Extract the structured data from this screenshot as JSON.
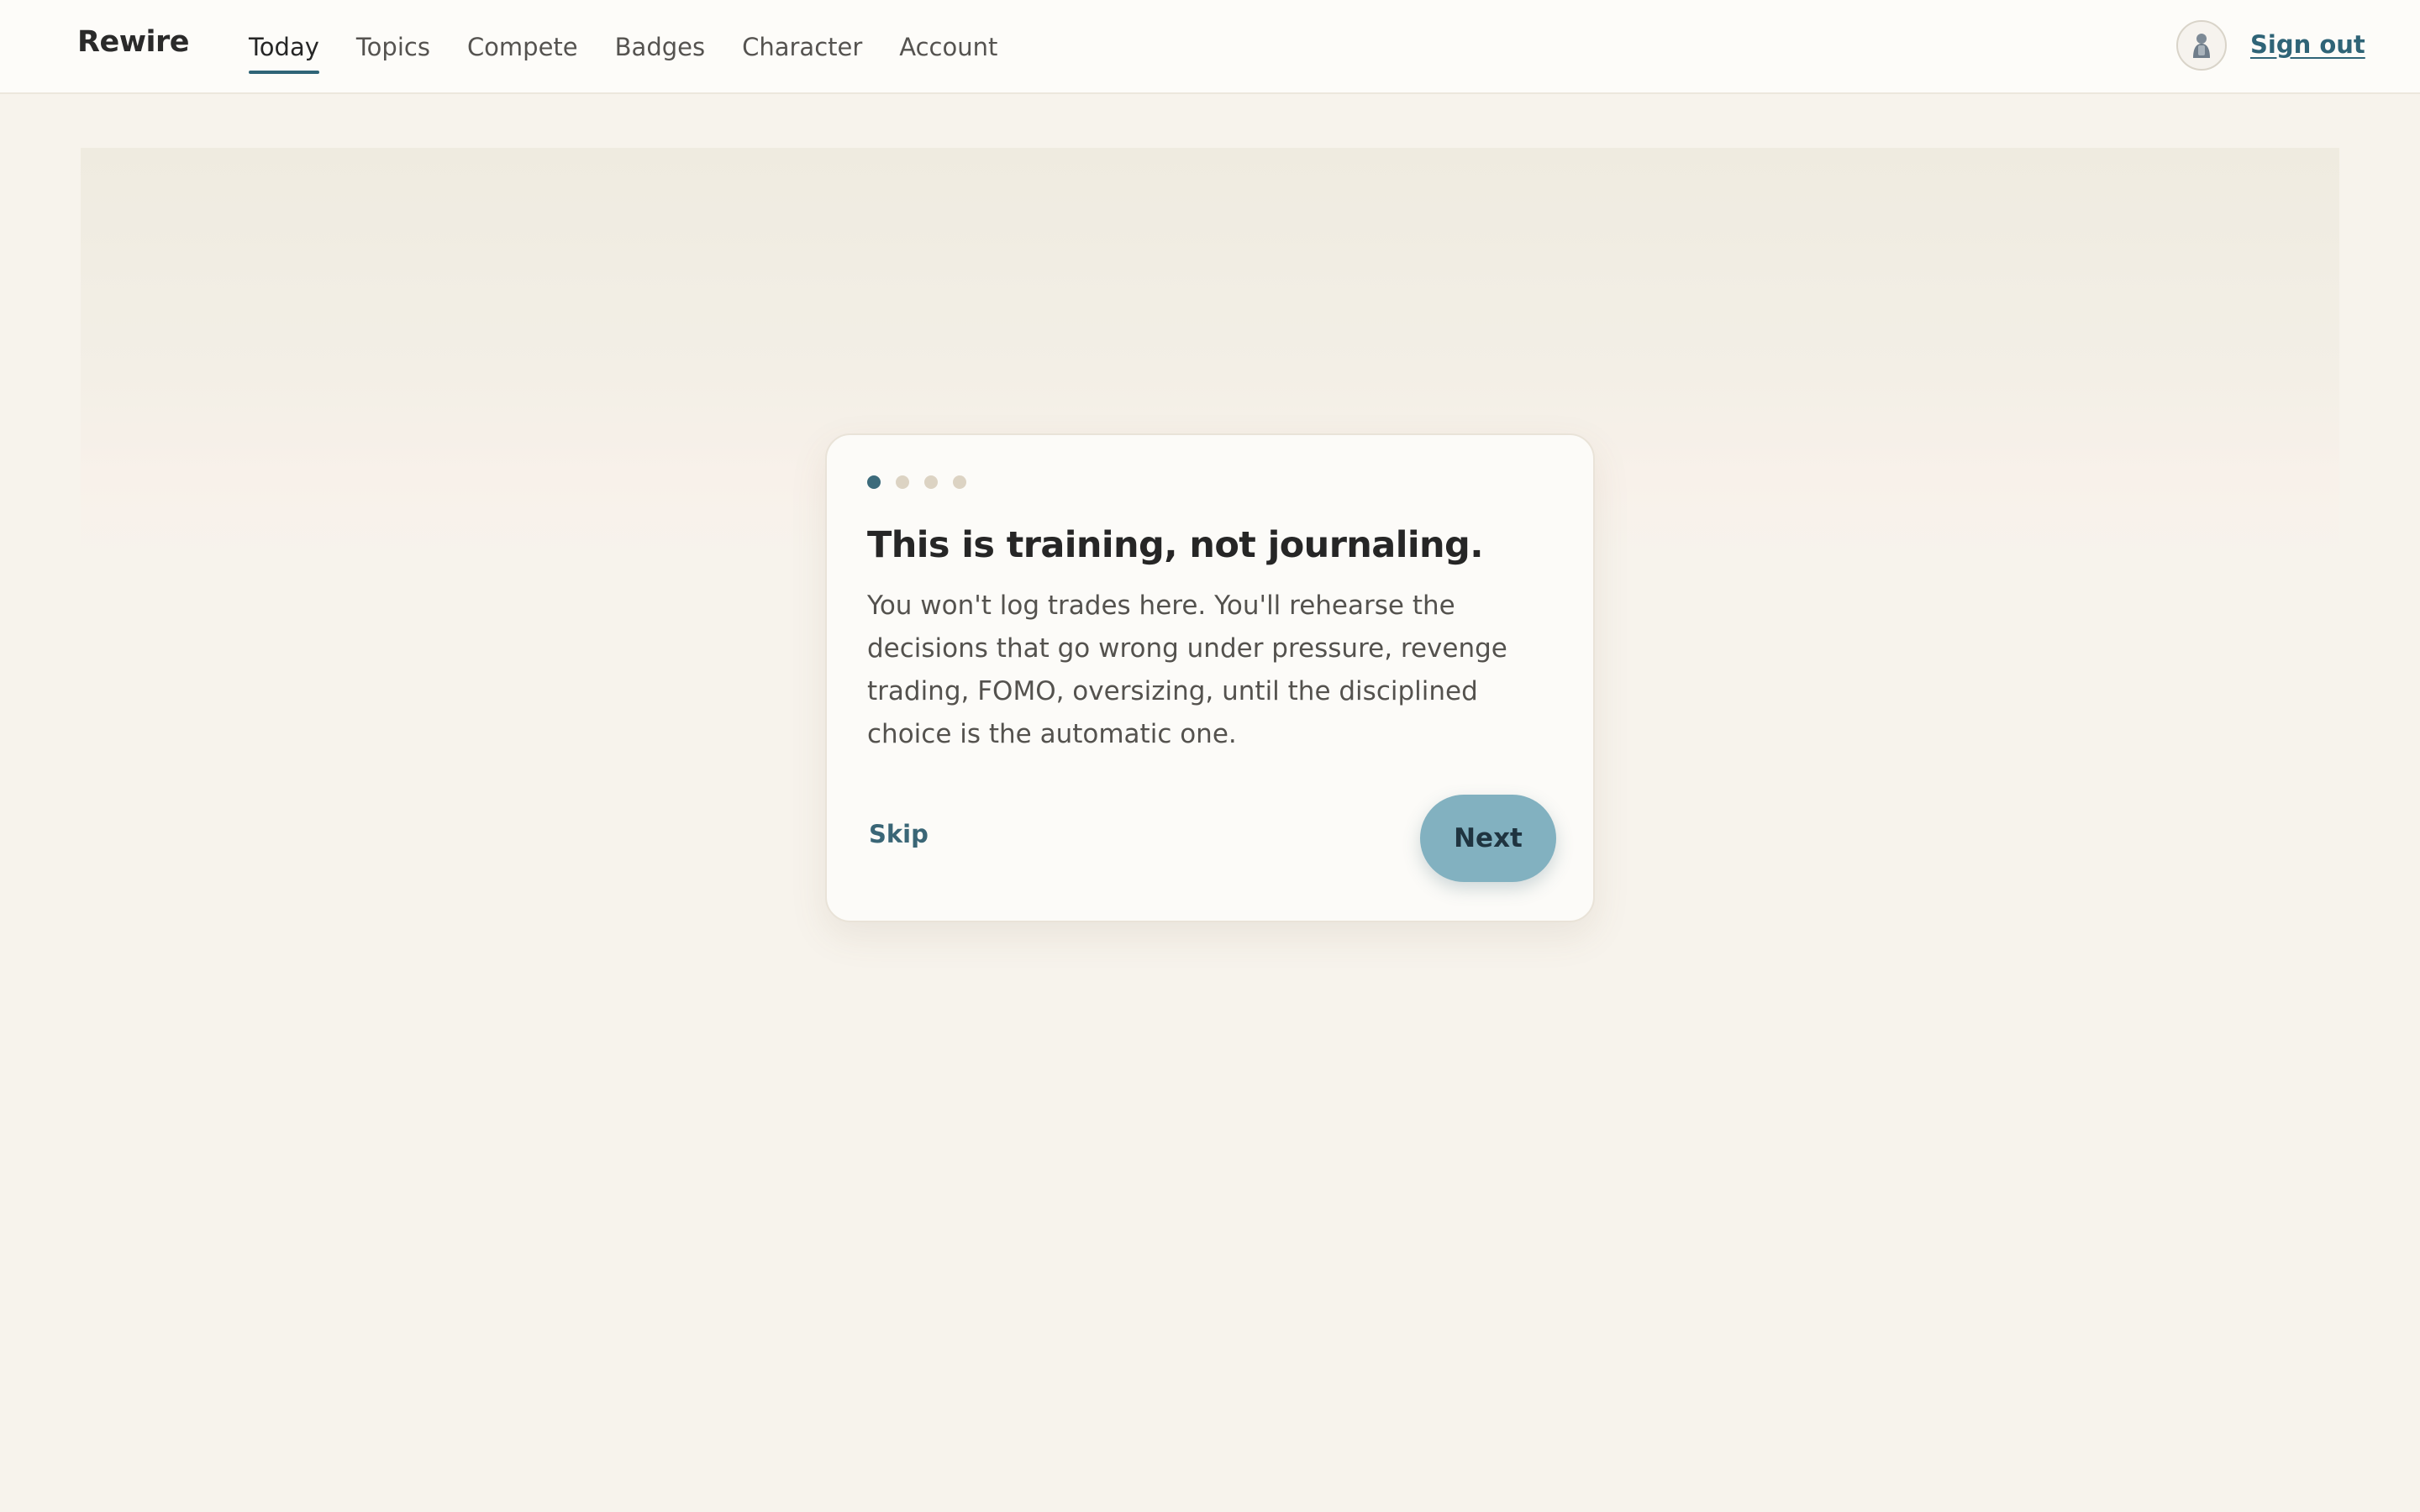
{
  "brand": {
    "name": "Rewire"
  },
  "nav": {
    "items": [
      {
        "label": "Today",
        "active": true
      },
      {
        "label": "Topics",
        "active": false
      },
      {
        "label": "Compete",
        "active": false
      },
      {
        "label": "Badges",
        "active": false
      },
      {
        "label": "Character",
        "active": false
      },
      {
        "label": "Account",
        "active": false
      }
    ]
  },
  "user": {
    "avatar_icon": "user-avatar-icon",
    "sign_out_label": "Sign out"
  },
  "onboarding": {
    "step": 1,
    "total_steps": 4,
    "title": "This is training, not journaling.",
    "body": "You won't log trades here. You'll rehearse the decisions that go wrong under pressure, revenge trading, FOMO, oversizing, until the disciplined choice is the automatic one.",
    "skip_label": "Skip",
    "next_label": "Next"
  },
  "colors": {
    "accent": "#2f6477",
    "button": "#82b1c0",
    "background": "#f7f3ec",
    "card": "#fcfbf8",
    "dot_inactive": "#dcd3c3"
  }
}
